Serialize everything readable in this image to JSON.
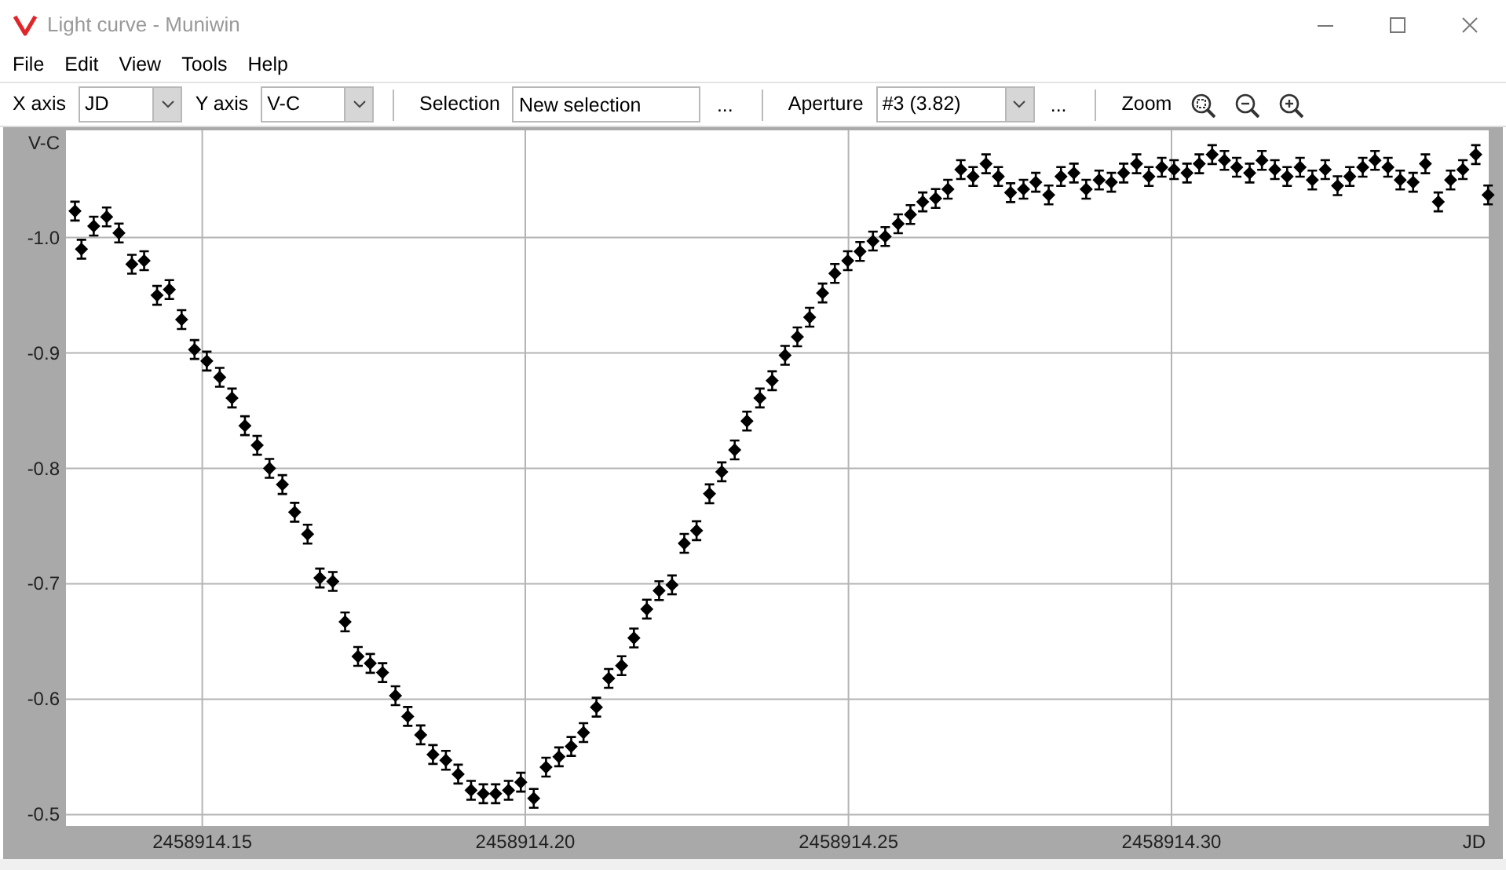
{
  "window": {
    "title": "Light curve - Muniwin"
  },
  "menu": [
    {
      "label": "File"
    },
    {
      "label": "Edit"
    },
    {
      "label": "View"
    },
    {
      "label": "Tools"
    },
    {
      "label": "Help"
    }
  ],
  "toolbar": [
    {
      "kind": "label",
      "text": "X axis"
    },
    {
      "kind": "combo",
      "value": "JD"
    },
    {
      "kind": "label",
      "text": "Y axis"
    },
    {
      "kind": "combo",
      "value": "V-C"
    },
    {
      "kind": "separator"
    },
    {
      "kind": "label",
      "text": "Selection"
    },
    {
      "kind": "field",
      "value": "New selection"
    },
    {
      "kind": "more",
      "text": "..."
    },
    {
      "kind": "separator"
    },
    {
      "kind": "label",
      "text": "Aperture"
    },
    {
      "kind": "combo",
      "value": "#3 (3.82)"
    },
    {
      "kind": "more",
      "text": "..."
    },
    {
      "kind": "separator"
    },
    {
      "kind": "label",
      "text": "Zoom"
    },
    {
      "kind": "zoom"
    }
  ],
  "plot": {
    "chart_data": {
      "type": "scatter",
      "grid": true,
      "xlabel": "JD",
      "ylabel": "V-C",
      "x": [
        2458914.1303,
        2458914.1313,
        2458914.1332,
        2458914.1352,
        2458914.1371,
        2458914.1391,
        2458914.141,
        2458914.143,
        2458914.1449,
        2458914.1468,
        2458914.1488,
        2458914.1507,
        2458914.1527,
        2458914.1546,
        2458914.1566,
        2458914.1585,
        2458914.1604,
        2458914.1624,
        2458914.1643,
        2458914.1663,
        2458914.1682,
        2458914.1702,
        2458914.1721,
        2458914.1741,
        2458914.176,
        2458914.1779,
        2458914.1799,
        2458914.1818,
        2458914.1838,
        2458914.1857,
        2458914.1877,
        2458914.1896,
        2458914.1916,
        2458914.1935,
        2458914.1954,
        2458914.1974,
        2458914.1993,
        2458914.2013,
        2458914.2032,
        2458914.2052,
        2458914.2071,
        2458914.209,
        2458914.211,
        2458914.2129,
        2458914.2149,
        2458914.2168,
        2458914.2188,
        2458914.2207,
        2458914.2227,
        2458914.2246,
        2458914.2265,
        2458914.2285,
        2458914.2304,
        2458914.2324,
        2458914.2343,
        2458914.2363,
        2458914.2382,
        2458914.2402,
        2458914.2421,
        2458914.244,
        2458914.246,
        2458914.2479,
        2458914.2499,
        2458914.2518,
        2458914.2538,
        2458914.2557,
        2458914.2577,
        2458914.2596,
        2458914.2615,
        2458914.2635,
        2458914.2654,
        2458914.2674,
        2458914.2693,
        2458914.2713,
        2458914.2732,
        2458914.2751,
        2458914.2771,
        2458914.279,
        2458914.281,
        2458914.2829,
        2458914.2849,
        2458914.2868,
        2458914.2888,
        2458914.2907,
        2458914.2926,
        2458914.2946,
        2458914.2965,
        2458914.2985,
        2458914.3004,
        2458914.3024,
        2458914.3043,
        2458914.3063,
        2458914.3082,
        2458914.3101,
        2458914.3121,
        2458914.314,
        2458914.316,
        2458914.3179,
        2458914.3199,
        2458914.3218,
        2458914.3238,
        2458914.3257,
        2458914.3276,
        2458914.3296,
        2458914.3315,
        2458914.3335,
        2458914.3354,
        2458914.3374,
        2458914.3393,
        2458914.3413,
        2458914.3432,
        2458914.3451,
        2458914.3471,
        2458914.349
      ],
      "series": [
        {
          "color": "#000000",
          "values": [
            -1.023,
            -0.99,
            -1.01,
            -1.018,
            -1.004,
            -0.977,
            -0.98,
            -0.95,
            -0.955,
            -0.929,
            -0.903,
            -0.893,
            -0.879,
            -0.861,
            -0.837,
            -0.82,
            -0.8,
            -0.786,
            -0.762,
            -0.743,
            -0.705,
            -0.702,
            -0.667,
            -0.637,
            -0.631,
            -0.623,
            -0.603,
            -0.585,
            -0.569,
            -0.552,
            -0.547,
            -0.535,
            -0.521,
            -0.518,
            -0.518,
            -0.521,
            -0.528,
            -0.514,
            -0.541,
            -0.55,
            -0.559,
            -0.571,
            -0.593,
            -0.618,
            -0.629,
            -0.653,
            -0.678,
            -0.694,
            -0.699,
            -0.735,
            -0.746,
            -0.778,
            -0.797,
            -0.816,
            -0.841,
            -0.861,
            -0.876,
            -0.898,
            -0.914,
            -0.931,
            -0.952,
            -0.969,
            -0.98,
            -0.988,
            -0.997,
            -1.001,
            -1.012,
            -1.02,
            -1.031,
            -1.034,
            -1.042,
            -1.059,
            -1.053,
            -1.064,
            -1.053,
            -1.039,
            -1.042,
            -1.048,
            -1.037,
            -1.053,
            -1.056,
            -1.042,
            -1.05,
            -1.048,
            -1.056,
            -1.064,
            -1.053,
            -1.061,
            -1.059,
            -1.056,
            -1.064,
            -1.072,
            -1.067,
            -1.061,
            -1.056,
            -1.067,
            -1.059,
            -1.053,
            -1.061,
            -1.05,
            -1.059,
            -1.045,
            -1.053,
            -1.061,
            -1.067,
            -1.061,
            -1.05,
            -1.048,
            -1.064,
            -1.031,
            -1.05,
            -1.059,
            -1.072,
            -1.037
          ]
        }
      ],
      "xlim": [
        2458914.1289,
        2458914.3491
      ],
      "ylim": [
        -0.49,
        -1.093
      ],
      "xticks": [
        {
          "value": 2458914.15,
          "label": "2458914.15"
        },
        {
          "value": 2458914.2,
          "label": "2458914.20"
        },
        {
          "value": 2458914.25,
          "label": "2458914.25"
        },
        {
          "value": 2458914.3,
          "label": "2458914.30"
        }
      ],
      "yticks": [
        {
          "value": -1.0,
          "label": "-1.0"
        },
        {
          "value": -0.9,
          "label": "-0.9"
        },
        {
          "value": -0.8,
          "label": "-0.8"
        },
        {
          "value": -0.7,
          "label": "-0.7"
        },
        {
          "value": -0.6,
          "label": "-0.6"
        },
        {
          "value": -0.5,
          "label": "-0.5"
        }
      ]
    }
  }
}
